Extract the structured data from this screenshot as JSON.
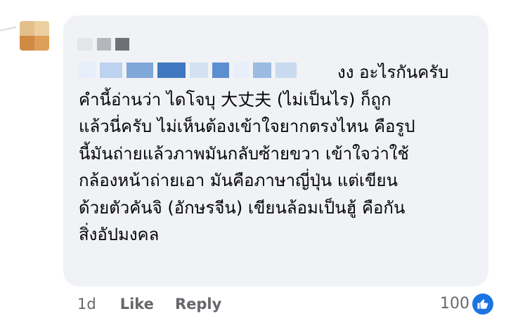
{
  "comment": {
    "lines": [
      "งง อะไรกันครับ",
      "คำนี้อ่านว่า ไดโจบุ 大丈夫 (ไม่เป็นไร) ก็ถูก",
      "แล้วนี่ครับ ไม่เห็นต้องเข้าใจยากตรงไหน คือรูป",
      "นี้มันถ่ายแล้วภาพมันกลับซ้ายขวา เข้าใจว่าใช้",
      "กล้องหน้าถ่ายเอา มันคือภาษาญี่ปุ่น แต่เขียน",
      "ด้วยตัวคันจิ (อักษรจีน) เขียนล้อมเป็นฮู้ คือกัน",
      "สิ่งอัปมงคล"
    ]
  },
  "footer": {
    "time": "1d",
    "like_label": "Like",
    "reply_label": "Reply",
    "reaction_count": "100"
  },
  "icons": {
    "reaction": "like-thumb-icon"
  },
  "colors": {
    "bubble": "#f0f2f5",
    "muted": "#65676b",
    "like": "#1b74e4"
  }
}
